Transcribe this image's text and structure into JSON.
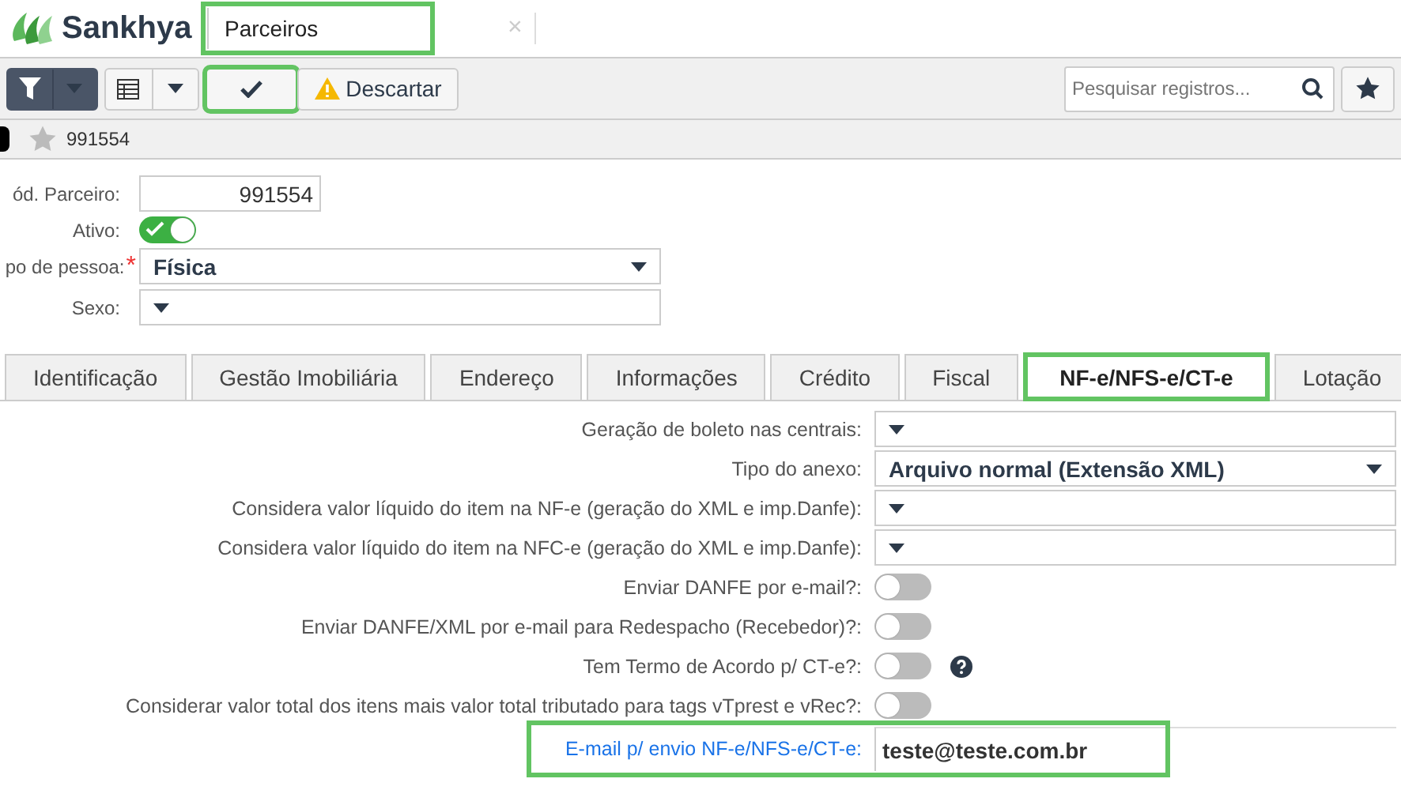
{
  "header": {
    "logo": "Sankhya",
    "tab": {
      "title": "Parceiros",
      "highlighted": true
    },
    "close": "×"
  },
  "toolbar": {
    "confirm": {
      "highlighted": true
    },
    "discard": "Descartar",
    "search": {
      "placeholder": "Pesquisar registros..."
    }
  },
  "record": {
    "code": "991554"
  },
  "form": {
    "code": {
      "label": "ód. Parceiro:",
      "value": "991554"
    },
    "active": {
      "label": "Ativo:",
      "on": true
    },
    "person_type": {
      "label": "po de pessoa:",
      "required_mark": "*",
      "value": "Física"
    },
    "sex": {
      "label": "Sexo:"
    }
  },
  "tabs": [
    {
      "label": "Identificação",
      "selected": false,
      "highlighted": false
    },
    {
      "label": "Gestão Imobiliária",
      "selected": false,
      "highlighted": false
    },
    {
      "label": "Endereço",
      "selected": false,
      "highlighted": false
    },
    {
      "label": "Informações",
      "selected": false,
      "highlighted": false
    },
    {
      "label": "Crédito",
      "selected": false,
      "highlighted": false
    },
    {
      "label": "Fiscal",
      "selected": false,
      "highlighted": false
    },
    {
      "label": "NF-e/NFS-e/CT-e",
      "selected": true,
      "highlighted": true
    },
    {
      "label": "Lotação",
      "selected": false,
      "highlighted": false
    }
  ],
  "fields": [
    {
      "kind": "select",
      "label": "Geração de boleto nas centrais:",
      "focused": false
    },
    {
      "kind": "select",
      "label": "Tipo do anexo:",
      "value": "Arquivo normal (Extensão XML)",
      "focused": false
    },
    {
      "kind": "select",
      "label": "Considera valor líquido do item na NF-e (geração do XML e imp.Danfe):",
      "focused": false
    },
    {
      "kind": "select",
      "label": "Considera valor líquido do item na NFC-e (geração do XML e imp.Danfe):",
      "focused": false
    },
    {
      "kind": "toggle",
      "label": "Enviar DANFE por e-mail?:",
      "on": false,
      "focused": false
    },
    {
      "kind": "toggle",
      "label": "Enviar DANFE/XML por e-mail para Redespacho (Recebedor)?:",
      "on": false,
      "focused": false
    },
    {
      "kind": "toggle",
      "label": "Tem Termo de Acordo p/ CT-e?:",
      "on": false,
      "help": true,
      "focused": false
    },
    {
      "kind": "toggle",
      "label": "Considerar valor total dos itens mais valor total tributado para tags vTprest e vRec?:",
      "on": false,
      "focused": false
    },
    {
      "kind": "text",
      "label": "E-mail p/ envio NF-e/NFS-e/CT-e:",
      "value": "teste@teste.com.br",
      "focused": true,
      "highlighted": true
    }
  ]
}
